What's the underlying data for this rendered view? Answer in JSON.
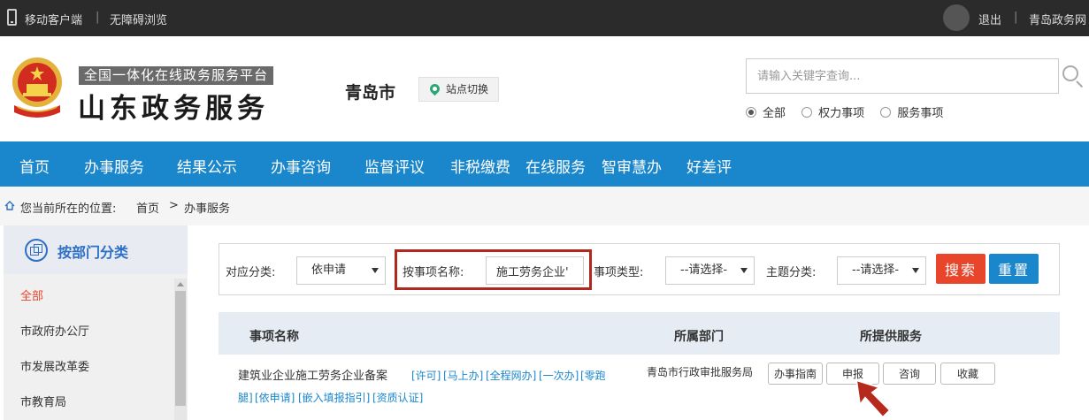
{
  "topbar": {
    "mobile": "移动客户端",
    "accessible": "无障碍浏览",
    "logout": "退出",
    "portal": "青岛政务网"
  },
  "header": {
    "platform_tag": "全国一体化在线政务服务平台",
    "title": "山东政务服务",
    "city": "青岛市",
    "switch_label": "站点切换",
    "search_placeholder": "请输入关键字查询...",
    "radios": [
      {
        "label": "全部",
        "checked": true
      },
      {
        "label": "权力事项",
        "checked": false
      },
      {
        "label": "服务事项",
        "checked": false
      }
    ]
  },
  "nav": [
    "首页",
    "办事服务",
    "结果公示",
    "办事咨询",
    "监督评议",
    "非税缴费",
    "在线服务",
    "智审慧办",
    "好差评"
  ],
  "breadcrumb": {
    "prefix": "您当前所在的位置:",
    "home": "首页",
    "sep": ">",
    "current": "办事服务"
  },
  "sidebar": {
    "title": "按部门分类",
    "items": [
      "全部",
      "市政府办公厅",
      "市发展改革委",
      "市教育局"
    ]
  },
  "filter": {
    "category_label": "对应分类:",
    "category_value": "依申请",
    "name_label": "按事项名称:",
    "name_value": "施工劳务企业'",
    "type_label": "事项类型:",
    "type_value": "--请选择-",
    "theme_label": "主题分类:",
    "theme_value": "--请选择-",
    "search_btn": "搜索",
    "reset_btn": "重置"
  },
  "table": {
    "headers": [
      "事项名称",
      "所属部门",
      "所提供服务"
    ],
    "row": {
      "name": "建筑业企业施工劳务企业备案",
      "tags_line1": [
        "[许可]",
        "[马上办]",
        "[全程网办]",
        "[一次办]",
        "[零跑"
      ],
      "tags_line2": [
        "腿]",
        "[依申请]",
        "[嵌入填报指引]",
        "[资质认证]"
      ],
      "dept": "青岛市行政审批服务局",
      "buttons": [
        "办事指南",
        "申报",
        "咨询",
        "收藏"
      ]
    }
  },
  "colors": {
    "nav_bg": "#1a87cd",
    "topbar_bg": "#2b2b2b",
    "search_btn": "#e8452b",
    "highlight_border": "#b0281e"
  }
}
